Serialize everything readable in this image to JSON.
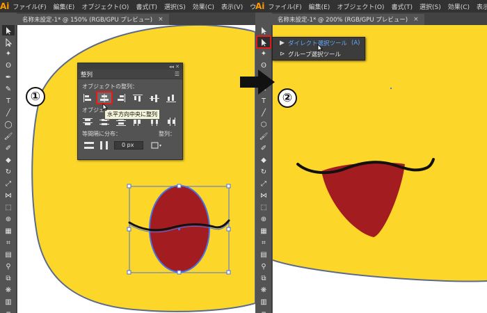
{
  "app": {
    "logo": "Ai"
  },
  "left": {
    "menu": [
      "ファイル(F)",
      "編集(E)",
      "オブジェクト(O)",
      "書式(T)",
      "選択(S)",
      "効果(C)",
      "表示(V)",
      "ウ"
    ],
    "tab": "名称未設定-1* @ 150% (RGB/GPU プレビュー)",
    "tab_close": "×",
    "step": "①",
    "panel": {
      "tab": "整列",
      "collapse": "◂◂ ✕",
      "menu": "☰",
      "section_align": "オブジェクトの整列：",
      "section_dist": "オブジェ",
      "section_spacing": "等間隔に分布：",
      "spacing_value": "0 px",
      "align_to": "整列："
    },
    "tooltip": "水平方向中央に整列"
  },
  "right": {
    "menu": [
      "ファイル(F)",
      "編集(E)",
      "オブジェクト(O)",
      "書式(T)",
      "選択(S)",
      "効果(C)",
      "表示(V)"
    ],
    "tab": "名称未設定-1* @ 200% (RGB/GPU プレビュー)",
    "tab_close": "×",
    "step": "②",
    "flyout": {
      "items": [
        {
          "label": "ダイレクト選択ツール",
          "key": "(A)"
        },
        {
          "label": "グループ選択ツール",
          "key": ""
        }
      ]
    }
  },
  "colors": {
    "face_fill": "#fcd629",
    "face_stroke": "#5a6a8c",
    "mouth": "#a31c20",
    "selection": "#4a72e8",
    "highlight": "#e41b1b"
  }
}
